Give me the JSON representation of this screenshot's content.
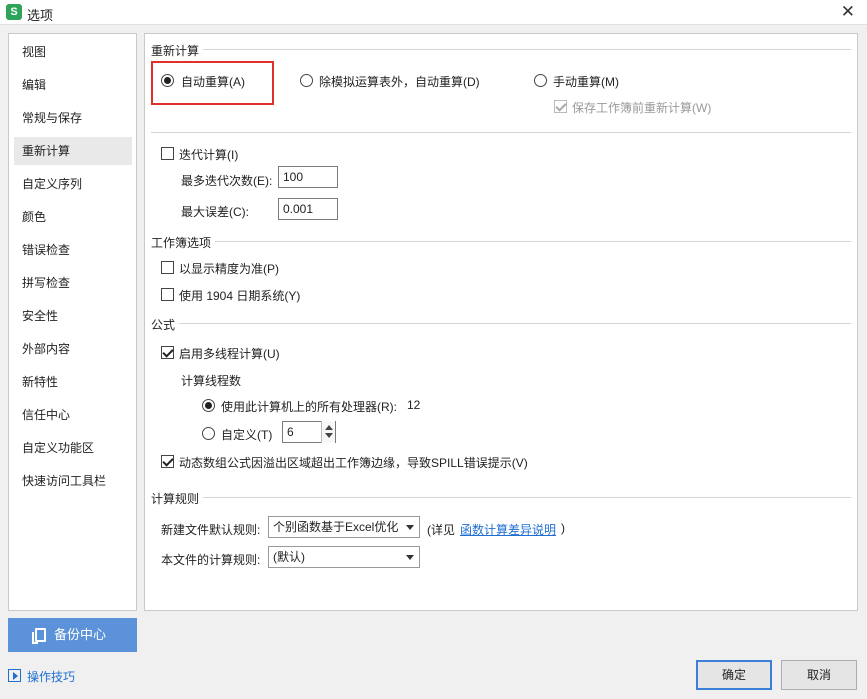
{
  "window": {
    "title": "选项",
    "app_icon_letter": "S"
  },
  "sidebar": {
    "items": [
      {
        "label": "视图"
      },
      {
        "label": "编辑"
      },
      {
        "label": "常规与保存"
      },
      {
        "label": "重新计算"
      },
      {
        "label": "自定义序列"
      },
      {
        "label": "颜色"
      },
      {
        "label": "错误检查"
      },
      {
        "label": "拼写检查"
      },
      {
        "label": "安全性"
      },
      {
        "label": "外部内容"
      },
      {
        "label": "新特性"
      },
      {
        "label": "信任中心"
      },
      {
        "label": "自定义功能区"
      },
      {
        "label": "快速访问工具栏"
      }
    ],
    "active": "重新计算"
  },
  "recalc": {
    "title": "重新计算",
    "auto": "自动重算(A)",
    "auto_except": "除模拟运算表外，自动重算(D)",
    "manual": "手动重算(M)",
    "save_before": "保存工作簿前重新计算(W)",
    "selected": "auto"
  },
  "iteration": {
    "label": "迭代计算(I)",
    "checked": false,
    "max_count_label": "最多迭代次数(E):",
    "max_count_value": "100",
    "max_change_label": "最大误差(C):",
    "max_change_value": "0.001"
  },
  "workbook": {
    "title": "工作簿选项",
    "precision": "以显示精度为准(P)",
    "date1904": "使用 1904 日期系统(Y)"
  },
  "formula": {
    "title": "公式",
    "multithread": "启用多线程计算(U)",
    "threads_title": "计算线程数",
    "use_all": "使用此计算机上的所有处理器(R):",
    "processor_count": "12",
    "custom": "自定义(T)",
    "custom_value": "6",
    "spill": "动态数组公式因溢出区域超出工作簿边缘，导致SPILL错误提示(V)"
  },
  "rules": {
    "title": "计算规则",
    "new_file_label": "新建文件默认规则:",
    "new_file_value": "个别函数基于Excel优化",
    "detail_prefix": "(详见",
    "detail_link": "函数计算差异说明",
    "detail_suffix": ")",
    "this_file_label": "本文件的计算规则:",
    "this_file_value": "(默认)"
  },
  "footer": {
    "backup": "备份中心",
    "tips": "操作技巧",
    "ok": "确定",
    "cancel": "取消"
  },
  "colors": {
    "accent": "#5b92d9",
    "highlight": "#e0302a",
    "link": "#1f6fd1"
  },
  "icons": {
    "close": "close-icon",
    "backup": "backup-icon",
    "tips": "play-icon"
  }
}
